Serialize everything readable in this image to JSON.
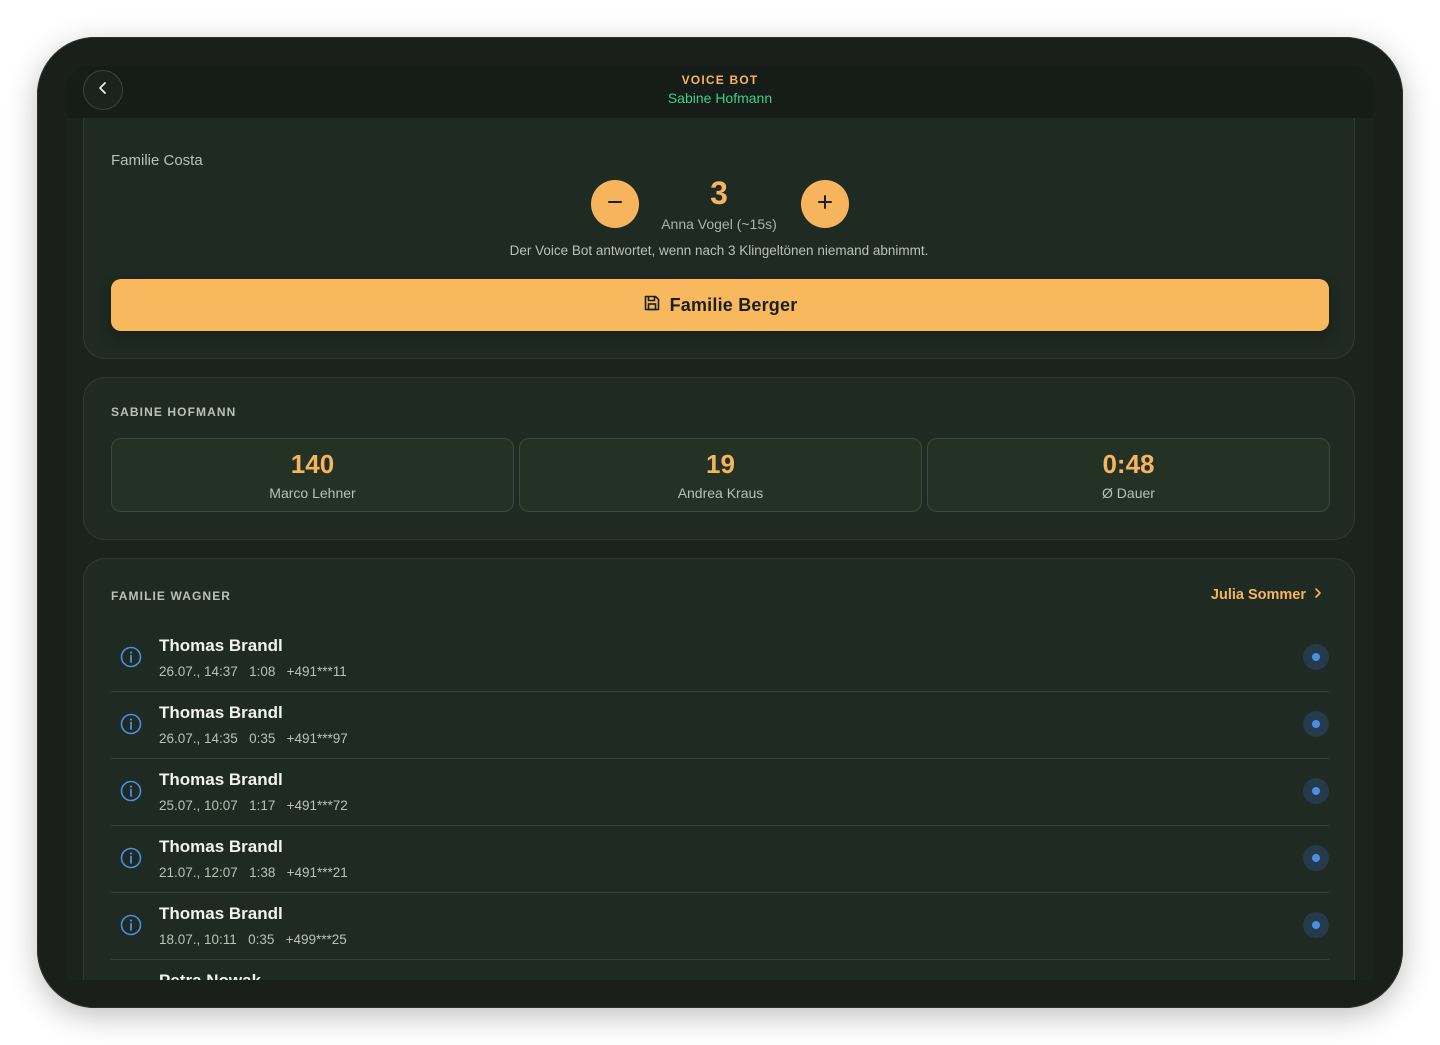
{
  "header": {
    "title": "VOICE BOT",
    "subtitle": "Sabine Hofmann"
  },
  "ring_settings": {
    "section_label": "Familie Costa",
    "rings_value": "3",
    "rings_caption": "Anna Vogel (~15s)",
    "helper_text": "Der Voice Bot antwortet, wenn nach 3 Klingeltönen niemand abnimmt.",
    "save_label": "Familie Berger"
  },
  "stats": {
    "section_label": "SABINE HOFMANN",
    "items": [
      {
        "value": "140",
        "label": "Marco Lehner"
      },
      {
        "value": "19",
        "label": "Andrea Kraus"
      },
      {
        "value": "0:48",
        "label": "Ø Dauer"
      }
    ]
  },
  "calls": {
    "section_label": "FAMILIE WAGNER",
    "link_label": "Julia Sommer",
    "items": [
      {
        "name": "Thomas Brandl",
        "meta": "26.07., 14:37   1:08   +491***11"
      },
      {
        "name": "Thomas Brandl",
        "meta": "26.07., 14:35   0:35   +491***97"
      },
      {
        "name": "Thomas Brandl",
        "meta": "25.07., 10:07   1:17   +491***72"
      },
      {
        "name": "Thomas Brandl",
        "meta": "21.07., 12:07   1:38   +491***21"
      },
      {
        "name": "Thomas Brandl",
        "meta": "18.07., 10:11   0:35   +499***25"
      },
      {
        "name": "Petra Nowak",
        "meta": ""
      }
    ]
  },
  "colors": {
    "accent": "#f6b55c",
    "subtitle_green": "#3ecf8e",
    "status_blue": "#4a90e2",
    "background": "#1b231e"
  }
}
